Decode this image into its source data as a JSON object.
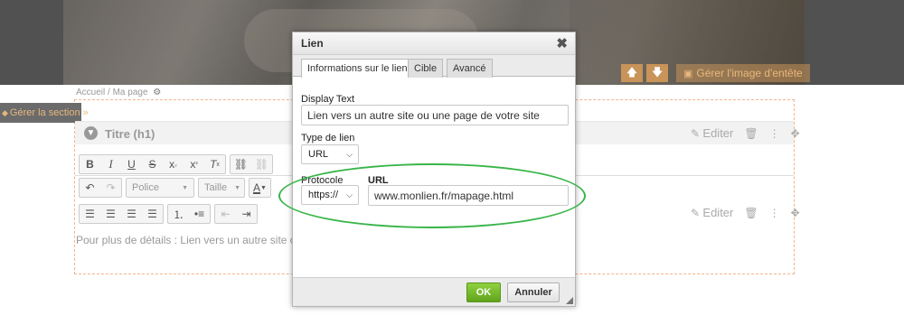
{
  "header": {
    "up_icon": "arrow-up-icon",
    "down_icon": "arrow-down-icon",
    "manage_image_label": "Gérer l'image d'entête"
  },
  "breadcrumb": {
    "home": "Accueil",
    "separator": "/",
    "current": "Ma page"
  },
  "section": {
    "manage_label": "Gérer la section »",
    "title_placeholder": "Titre (h1)",
    "edit_label": "Editer",
    "content_text": "Pour plus de détails : Lien vers un autre site o"
  },
  "editor": {
    "font_combo": "Police",
    "size_combo": "Taille"
  },
  "dialog": {
    "title": "Lien",
    "tabs": [
      {
        "label": "Informations sur le lien"
      },
      {
        "label": "Cible"
      },
      {
        "label": "Avancé"
      }
    ],
    "display_text_label": "Display Text",
    "display_text_value": "Lien vers un autre site ou une page de votre site",
    "link_type_label": "Type de lien",
    "link_type_value": "URL",
    "protocol_label": "Protocole",
    "protocol_value": "https://",
    "url_label": "URL",
    "url_value": "www.monlien.fr/mapage.html",
    "ok_label": "OK",
    "cancel_label": "Annuler"
  },
  "colors": {
    "accent": "#c8945a",
    "ok_green": "#61a51e",
    "highlight": "#3ab54a"
  }
}
